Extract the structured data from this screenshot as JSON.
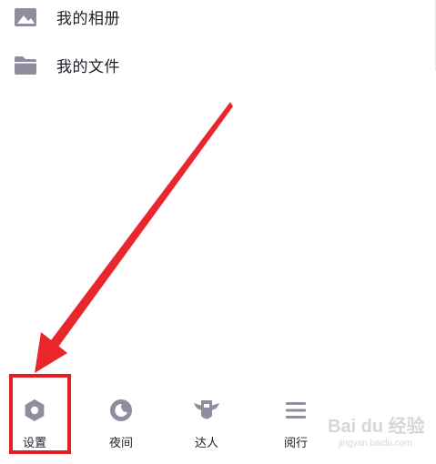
{
  "menu": {
    "items": [
      {
        "icon": "image-icon",
        "label": "我的相册"
      },
      {
        "icon": "folder-icon",
        "label": "我的文件"
      }
    ]
  },
  "bottom_bar": {
    "tabs": [
      {
        "icon": "settings-hexagon-icon",
        "label": "设置"
      },
      {
        "icon": "moon-icon",
        "label": "夜间"
      },
      {
        "icon": "winged-badge-icon",
        "label": "达人"
      },
      {
        "icon": "list-lines-icon",
        "label": "阅行"
      }
    ]
  },
  "annotation": {
    "highlight_color": "#e31e24",
    "arrow_color": "#e8262b",
    "target": "设置"
  },
  "colors": {
    "icon_gray": "#8e8e9e",
    "text": "#1e1e28"
  },
  "watermark": {
    "main": "Bai du 经验",
    "url": "jingyan.baidu.com"
  }
}
